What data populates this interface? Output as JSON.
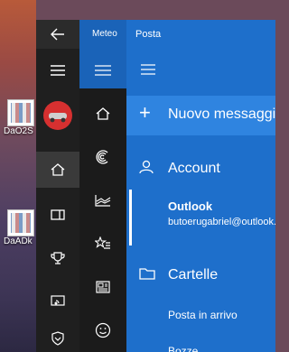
{
  "desktop": {
    "icons": [
      {
        "label": "DaO2S"
      },
      {
        "label": "DaADk"
      }
    ]
  },
  "settings_panel": {
    "back_icon": "back-arrow-icon",
    "menu_icon": "hamburger-icon",
    "items": [
      "home-icon",
      "video-icon",
      "trophy-icon",
      "broadcast-icon",
      "shield-icon"
    ]
  },
  "weather_app": {
    "title": "Meteo",
    "items": [
      "home-icon",
      "forecast-icon",
      "chart-icon",
      "favorites-icon",
      "news-icon",
      "smiley-icon"
    ]
  },
  "mail_app": {
    "title": "Posta",
    "new_message_label": "Nuovo messaggio",
    "accounts_label": "Account",
    "account": {
      "name": "Outlook",
      "email": "butoerugabriel@outlook.com"
    },
    "folders_label": "Cartelle",
    "folders": [
      "Posta in arrivo",
      "Bozze"
    ]
  },
  "colors": {
    "mail_blue": "#1e6fcb",
    "weather_blue": "#1a63b8",
    "dark_panel": "#1f1f1f"
  }
}
